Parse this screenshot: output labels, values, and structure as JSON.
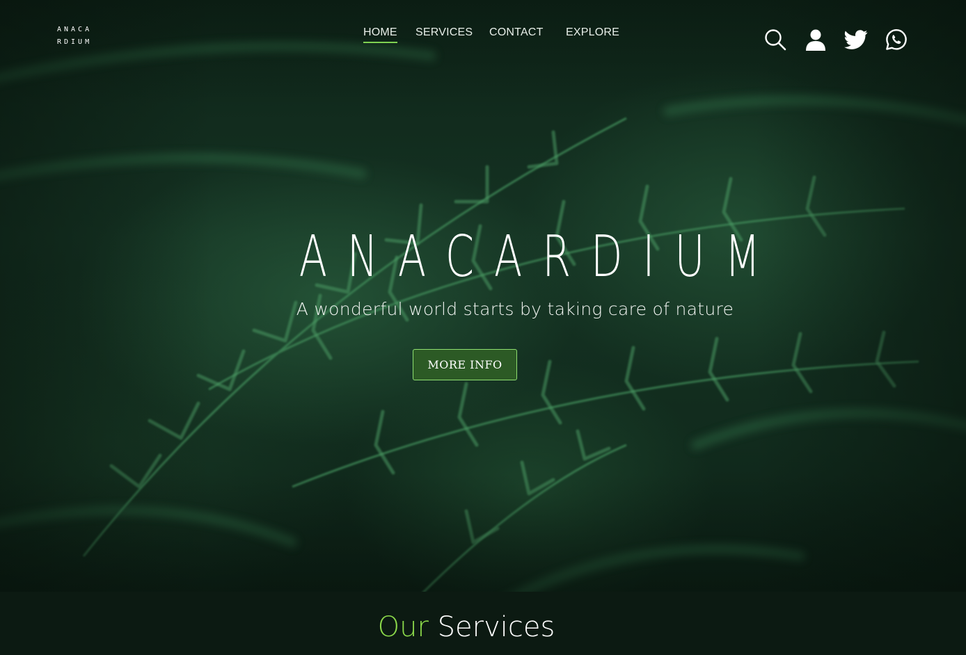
{
  "brand": {
    "logo_line1": "ANACA",
    "logo_line2": "RDIUM"
  },
  "nav": {
    "items": [
      {
        "label": "HOME",
        "active": true
      },
      {
        "label": "SERVICES",
        "active": false
      },
      {
        "label": "CONTACT",
        "active": false
      },
      {
        "label": "EXPLORE",
        "active": false
      }
    ]
  },
  "header_icons": [
    "search-icon",
    "user-icon",
    "twitter-icon",
    "whatsapp-icon"
  ],
  "hero": {
    "title": "ANACARDIUM",
    "subtitle": "A wonderful world starts by taking care of nature",
    "cta_label": "MORE INFO"
  },
  "services": {
    "heading_accent": "Our",
    "heading_rest": "Services"
  },
  "colors": {
    "accent": "#8bd84a",
    "cta_background": "#2c5a25",
    "cta_border": "#8fe070",
    "hero_dark": "#0e2418",
    "services_background": "#0c1a12"
  }
}
